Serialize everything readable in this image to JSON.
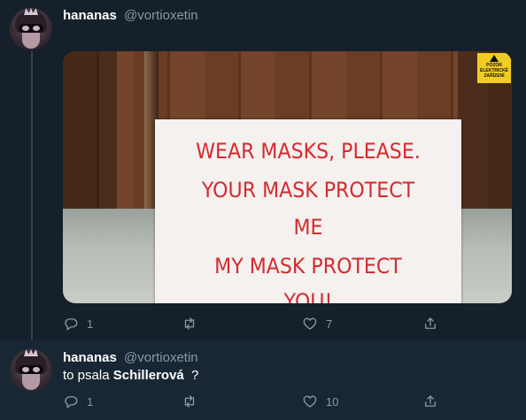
{
  "tweets": [
    {
      "name": "hananas",
      "handle": "@vortioxetin",
      "text": "",
      "sign_lines": [
        "WEAR MASKS, PLEASE.",
        "YOUR MASK PROTECT",
        "ME",
        "MY MASK PROTECT",
        "YOU!"
      ],
      "warning_label": [
        "POZOR",
        "ELEKTRICKÉ",
        "ZAŘÍZENÍ"
      ],
      "replies": "1",
      "retweets": "",
      "likes": "7"
    },
    {
      "name": "hananas",
      "handle": "@vortioxetin",
      "text_prefix": "to psala",
      "text_bold": "Schillerová",
      "text_suffix": "?",
      "replies": "1",
      "retweets": "",
      "likes": "10"
    }
  ],
  "icons": [
    "reply-icon",
    "retweet-icon",
    "like-icon",
    "share-icon"
  ],
  "colors": {
    "background": "#15202b",
    "secondary_text": "#8899a6",
    "sign_text": "#d52a2f"
  }
}
